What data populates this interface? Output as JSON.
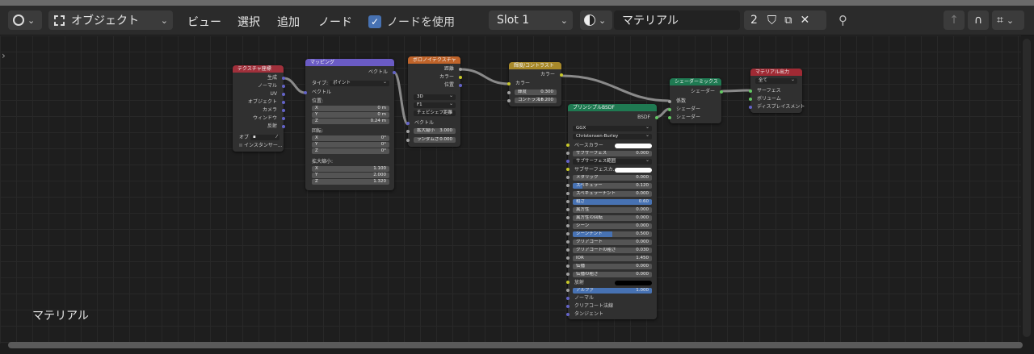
{
  "header": {
    "mode_label": "オブジェクト",
    "menus": [
      "ビュー",
      "選択",
      "追加",
      "ノード"
    ],
    "use_nodes_label": "ノードを使用",
    "slot_label": "Slot 1",
    "material_name": "マテリアル",
    "user_count": "2"
  },
  "canvas": {
    "label": "マテリアル"
  },
  "colors": {
    "input": "#a1303b",
    "vector": "#6a5bc4",
    "texture": "#c0642a",
    "color": "#a8892a",
    "shader": "#1f7a52",
    "output": "#a02a34",
    "socket_vector": "#6363c7",
    "socket_color": "#c7c729",
    "socket_float": "#a1a1a1",
    "socket_shader": "#63c763"
  },
  "nodes": {
    "texcoord": {
      "title": "テクスチャ座標",
      "outputs": [
        "生成",
        "ノーマル",
        "UV",
        "オブジェクト",
        "カメラ",
        "ウィンドウ",
        "反射"
      ],
      "obj_label": "オブ",
      "instancer_label": "インスタンサー..."
    },
    "mapping": {
      "title": "マッピング",
      "out": "ベクトル",
      "type_label": "タイプ:",
      "type_value": "ポイント",
      "vector_label": "ベクトル",
      "loc_label": "位置:",
      "loc": [
        {
          "k": "X",
          "v": "0 m"
        },
        {
          "k": "Y",
          "v": "0 m"
        },
        {
          "k": "Z",
          "v": "0.24 m"
        }
      ],
      "rot_label": "回転:",
      "rot": [
        {
          "k": "X",
          "v": "0°"
        },
        {
          "k": "Y",
          "v": "0°"
        },
        {
          "k": "Z",
          "v": "0°"
        }
      ],
      "scale_label": "拡大縮小:",
      "scale": [
        {
          "k": "X",
          "v": "1.100"
        },
        {
          "k": "Y",
          "v": "2.000"
        },
        {
          "k": "Z",
          "v": "1.320"
        }
      ]
    },
    "voronoi": {
      "title": "ボロノイテクスチャ",
      "outputs": [
        "距離",
        "カラー",
        "位置"
      ],
      "dim": "3D",
      "feature": "F1",
      "metric": "チェビシェフ距離",
      "vector_label": "ベクトル",
      "scale": {
        "k": "拡大縮小",
        "v": "3.000"
      },
      "random": {
        "k": "ランダムさ",
        "v": "0.000"
      }
    },
    "brightcontrast": {
      "title": "輝度/コントラスト",
      "out": "カラー",
      "in_color": "カラー",
      "bright": {
        "k": "輝度",
        "v": "0.300"
      },
      "contrast": {
        "k": "コントラスト",
        "v": "16.200"
      }
    },
    "bsdf": {
      "title": "プリンシプルBSDF",
      "out": "BSDF",
      "dist": "GGX",
      "sss_method": "Christensen-Burley",
      "rows": [
        {
          "k": "ベースカラー",
          "type": "color",
          "c": "#ffffff"
        },
        {
          "k": "サブサーフェス",
          "v": "0.000"
        },
        {
          "k": "サブサーフェス範囲",
          "type": "dd"
        },
        {
          "k": "サブサーフェスカ...",
          "type": "color",
          "c": "#ffffff"
        },
        {
          "k": "メタリック",
          "v": "0.000"
        },
        {
          "k": "スペキュラー",
          "v": "0.120",
          "fill": 0.12
        },
        {
          "k": "スペキュラーチント",
          "v": "0.000"
        },
        {
          "k": "粗さ",
          "v": "0.60",
          "fill": 1
        },
        {
          "k": "異方性",
          "v": "0.000"
        },
        {
          "k": "異方性の回転",
          "v": "0.000"
        },
        {
          "k": "シーン",
          "v": "0.000"
        },
        {
          "k": "シーンチント",
          "v": "0.500",
          "fill": 0.5
        },
        {
          "k": "クリアコート",
          "v": "0.000"
        },
        {
          "k": "クリアコートの粗さ",
          "v": "0.030"
        },
        {
          "k": "IOR",
          "v": "1.450"
        },
        {
          "k": "伝播",
          "v": "0.000"
        },
        {
          "k": "伝播の粗さ",
          "v": "0.000"
        },
        {
          "k": "放射",
          "type": "color",
          "c": "#000000"
        },
        {
          "k": "アルファ",
          "v": "1.000",
          "fill": 1
        }
      ],
      "extra": [
        "ノーマル",
        "クリアコート法線",
        "タンジェント"
      ]
    },
    "mix": {
      "title": "シェーダーミックス",
      "out": "シェーダー",
      "inputs": [
        "係数",
        "シェーダー",
        "シェーダー"
      ]
    },
    "output": {
      "title": "マテリアル出力",
      "target": "全て",
      "inputs": [
        "サーフェス",
        "ボリューム",
        "ディスプレイスメント"
      ]
    }
  }
}
